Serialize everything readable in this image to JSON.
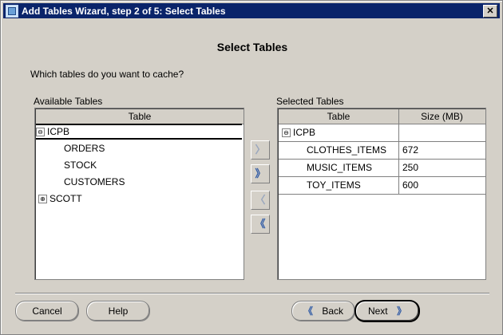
{
  "window": {
    "title": "Add Tables Wizard, step 2 of 5: Select Tables",
    "close_glyph": "✕"
  },
  "heading": "Select Tables",
  "question": "Which tables do you want to cache?",
  "available": {
    "label": "Available Tables",
    "column_header": "Table",
    "tree": [
      {
        "label": "ICPB",
        "expander": "⊖"
      },
      {
        "label": "ORDERS"
      },
      {
        "label": "STOCK"
      },
      {
        "label": "CUSTOMERS"
      },
      {
        "label": "SCOTT",
        "expander": "⊕"
      }
    ]
  },
  "move_buttons": {
    "add_one": "〉",
    "add_all": "》",
    "remove_one": "〈",
    "remove_all": "《"
  },
  "selected": {
    "label": "Selected Tables",
    "headers": [
      "Table",
      "Size (MB)"
    ],
    "group": {
      "label": "ICPB",
      "expander": "⊖"
    },
    "rows": [
      {
        "table": "CLOTHES_ITEMS",
        "size": "672"
      },
      {
        "table": "MUSIC_ITEMS",
        "size": "250"
      },
      {
        "table": "TOY_ITEMS",
        "size": "600"
      }
    ]
  },
  "buttons": {
    "cancel": "Cancel",
    "help": "Help",
    "back": "Back",
    "next": "Next",
    "back_chevron": "《",
    "next_chevron": "》"
  }
}
